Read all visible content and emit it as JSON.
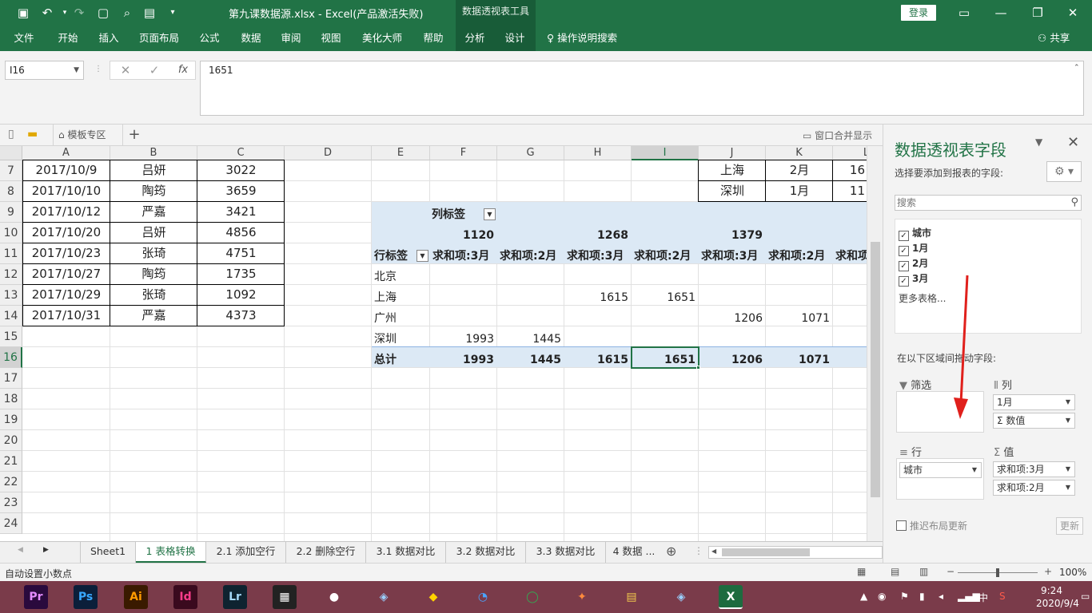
{
  "window": {
    "doc_title": "第九课数据源.xlsx - Excel(产品激活失败)",
    "context_tool": "数据透视表工具",
    "login_label": "登录"
  },
  "ribbon": {
    "tabs": [
      "文件",
      "开始",
      "插入",
      "页面布局",
      "公式",
      "数据",
      "审阅",
      "视图",
      "美化大师",
      "帮助",
      "分析",
      "设计"
    ],
    "tell_me": "操作说明搜索",
    "share": "共享"
  },
  "formula_bar": {
    "name_box": "I16",
    "fx": "fx",
    "value": "1651"
  },
  "workbook_bar": {
    "template_tab": "模板专区",
    "merge_window": "窗口合并显示"
  },
  "grid": {
    "columns": [
      "A",
      "B",
      "C",
      "D",
      "E",
      "F",
      "G",
      "H",
      "I",
      "J",
      "K",
      "L"
    ],
    "selected_column": "I",
    "rows": [
      "7",
      "8",
      "9",
      "10",
      "11",
      "12",
      "13",
      "14",
      "15",
      "16",
      "17",
      "18",
      "19",
      "20",
      "21",
      "22",
      "23",
      "24"
    ],
    "selected_row": "16",
    "left_table": [
      [
        "2017/10/9",
        "吕妍",
        "3022"
      ],
      [
        "2017/10/10",
        "陶筠",
        "3659"
      ],
      [
        "2017/10/12",
        "严嘉",
        "3421"
      ],
      [
        "2017/10/20",
        "吕妍",
        "4856"
      ],
      [
        "2017/10/23",
        "张琦",
        "4751"
      ],
      [
        "2017/10/27",
        "陶筠",
        "1735"
      ],
      [
        "2017/10/29",
        "张琦",
        "1092"
      ],
      [
        "2017/10/31",
        "严嘉",
        "4373"
      ]
    ],
    "top_right_table": [
      [
        "上海",
        "2月",
        "16"
      ],
      [
        "深圳",
        "1月",
        "11"
      ]
    ]
  },
  "pivot": {
    "col_label": "列标签",
    "row_label": "行标签",
    "col_groups": [
      "1120",
      "1268",
      "1379"
    ],
    "value_headers": [
      "求和项:3月",
      "求和项:2月",
      "求和项:3月",
      "求和项:2月",
      "求和项:3月",
      "求和项:2月",
      "求和项"
    ],
    "rows": [
      {
        "label": "北京",
        "values": [
          "",
          "",
          "",
          "",
          "",
          "",
          ""
        ]
      },
      {
        "label": "上海",
        "values": [
          "",
          "",
          "1615",
          "1651",
          "",
          "",
          ""
        ]
      },
      {
        "label": "广州",
        "values": [
          "",
          "",
          "",
          "",
          "1206",
          "1071",
          ""
        ]
      },
      {
        "label": "深圳",
        "values": [
          "1993",
          "1445",
          "",
          "",
          "",
          "",
          ""
        ]
      }
    ],
    "total": {
      "label": "总计",
      "values": [
        "1993",
        "1445",
        "1615",
        "1651",
        "1206",
        "1071",
        ""
      ]
    }
  },
  "sheet_tabs": [
    "Sheet1",
    "1 表格转换",
    "2.1 添加空行",
    "2.2 删除空行",
    "3.1 数据对比",
    "3.2 数据对比",
    "3.3 数据对比",
    "4 数据 ..."
  ],
  "active_sheet": "1 表格转换",
  "pivot_pane": {
    "title": "数据透视表字段",
    "subtitle": "选择要添加到报表的字段:",
    "search_placeholder": "搜索",
    "fields": [
      {
        "name": "城市",
        "checked": true
      },
      {
        "name": "1月",
        "checked": true
      },
      {
        "name": "2月",
        "checked": true
      },
      {
        "name": "3月",
        "checked": true
      }
    ],
    "more_tables": "更多表格...",
    "drag_label": "在以下区域间拖动字段:",
    "areas": {
      "filter": {
        "title": "筛选",
        "items": []
      },
      "columns": {
        "title": "列",
        "items": [
          "1月",
          "Σ 数值"
        ]
      },
      "rows": {
        "title": "行",
        "items": [
          "城市"
        ]
      },
      "values": {
        "title": "值",
        "items": [
          "求和项:3月",
          "求和项:2月"
        ]
      }
    },
    "defer_text": "推迟布局更新",
    "update_label": "更新"
  },
  "status_bar": {
    "text": "自动设置小数点",
    "zoom": "100%"
  },
  "taskbar": {
    "apps": [
      {
        "label": "Pr",
        "color": "#2a0a3d",
        "fg": "#e48cff"
      },
      {
        "label": "Ps",
        "color": "#0b1f3a",
        "fg": "#38a8ff"
      },
      {
        "label": "Ai",
        "color": "#3a1a00",
        "fg": "#ff9a00"
      },
      {
        "label": "Id",
        "color": "#3a0a1e",
        "fg": "#ff3d8b"
      },
      {
        "label": "Lr",
        "color": "#0e2330",
        "fg": "#a3d6f5"
      },
      {
        "label": "▦",
        "color": "#222222",
        "fg": "#ffffff"
      },
      {
        "label": "●",
        "color": "#7a3b4a",
        "fg": "#ffffff"
      },
      {
        "label": "◆",
        "color": "#7a3b4a",
        "fg": "#ffd400"
      },
      {
        "label": "◔",
        "color": "#7a3b4a",
        "fg": "#4aa3ff"
      },
      {
        "label": "◯",
        "color": "#7a3b4a",
        "fg": "#34a853"
      },
      {
        "label": "✦",
        "color": "#7a3b4a",
        "fg": "#ff8a3d"
      },
      {
        "label": "▤",
        "color": "#7a3b4a",
        "fg": "#f2c94c"
      },
      {
        "label": "◈",
        "color": "#7a3b4a",
        "fg": "#9ad0ff"
      },
      {
        "label": "X",
        "color": "#1d6b3f",
        "fg": "#ffffff"
      }
    ],
    "time": "9:24",
    "date": "2020/9/4",
    "ime": "中"
  },
  "colors": {
    "excel_green": "#217346",
    "pivot_blue": "#dce9f5",
    "taskbar": "#7a3b4a"
  }
}
